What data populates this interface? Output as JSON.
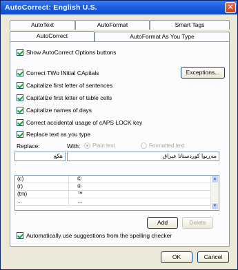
{
  "window": {
    "title": "AutoCorrect: English U.S.",
    "close_glyph": "✕"
  },
  "tabs": {
    "row1": [
      "AutoText",
      "AutoFormat",
      "Smart Tags"
    ],
    "row2": [
      "AutoCorrect",
      "AutoFormat As You Type"
    ],
    "active": "AutoCorrect"
  },
  "options": {
    "show_buttons": "Show AutoCorrect Options buttons",
    "two_initial_caps": "Correct TWo INitial CApitals",
    "cap_sentences": "Capitalize first letter of sentences",
    "cap_table_cells": "Capitalize first letter of table cells",
    "cap_days": "Capitalize names of days",
    "caps_lock": "Correct accidental usage of cAPS LOCK key",
    "replace_as_type": "Replace text as you type",
    "auto_suggest": "Automatically use suggestions from the spelling checker"
  },
  "buttons": {
    "exceptions": "Exceptions...",
    "add": "Add",
    "delete": "Delete",
    "ok": "OK",
    "cancel": "Cancel"
  },
  "replace": {
    "replace_label": "Replace:",
    "with_label": "With:",
    "plain_text": "Plain text",
    "formatted_text": "Formatted text",
    "replace_value": "هکع",
    "with_value": "مەڕیوا کوردستانا عیراق"
  },
  "list": [
    {
      "from": "(c)",
      "to": "©"
    },
    {
      "from": "(r)",
      "to": "®"
    },
    {
      "from": "(tm)",
      "to": "™"
    },
    {
      "from": "...",
      "to": "…"
    }
  ],
  "colors": {
    "titlebar": "#1c5ce0",
    "dialog_bg": "#ece9d8",
    "check_green": "#21a121"
  }
}
